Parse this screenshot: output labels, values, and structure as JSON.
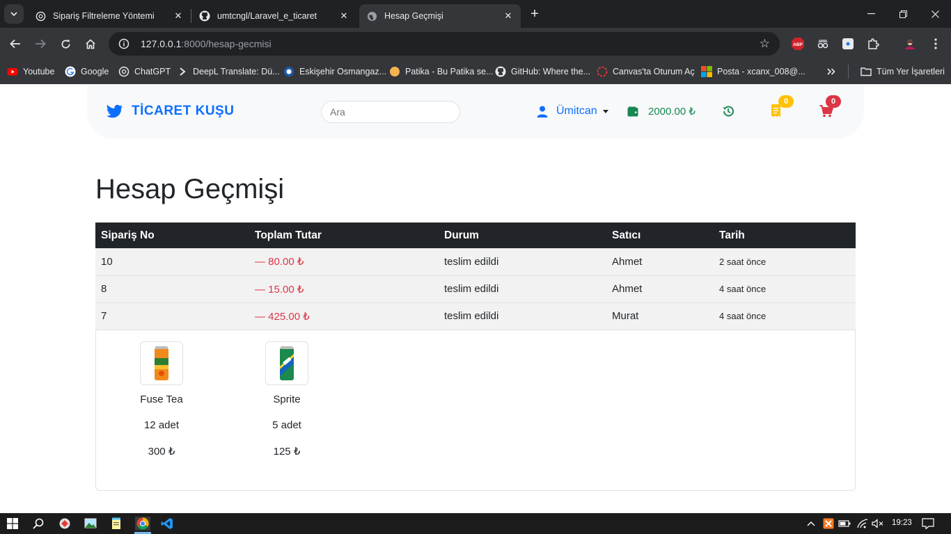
{
  "browser": {
    "tabs": [
      {
        "label": "Sipariş Filtreleme Yöntemi",
        "icon": "chatgpt-icon"
      },
      {
        "label": "umtcngl/Laravel_e_ticaret",
        "icon": "github-icon"
      },
      {
        "label": "Hesap Geçmişi",
        "icon": "globe-icon"
      }
    ],
    "url_host": "127.0.0.1",
    "url_rest": ":8000/hesap-gecmisi",
    "bookmarks": [
      "Youtube",
      "Google",
      "ChatGPT",
      "DeepL Translate: Dü...",
      "Eskişehir Osmangaz...",
      "Patika - Bu Patika se...",
      "GitHub: Where the...",
      "Canvas'ta Oturum Aç",
      "Posta - xcanx_008@...",
      "Tüm Yer İşaretleri"
    ],
    "extension_abp": "ABP"
  },
  "navbar": {
    "brand": "TİCARET KUŞU",
    "search_placeholder": "Ara",
    "user": "Ümitcan",
    "balance": "2000.00 ₺",
    "orders_badge": "0",
    "cart_badge": "0"
  },
  "page": {
    "title": "Hesap Geçmişi",
    "columns": [
      "Sipariş No",
      "Toplam Tutar",
      "Durum",
      "Satıcı",
      "Tarih"
    ],
    "rows": [
      {
        "no": "10",
        "amount": "80.00 ₺",
        "status": "teslim edildi",
        "seller": "Ahmet",
        "date": "2 saat önce"
      },
      {
        "no": "8",
        "amount": "15.00 ₺",
        "status": "teslim edildi",
        "seller": "Ahmet",
        "date": "4 saat önce"
      },
      {
        "no": "7",
        "amount": "425.00 ₺",
        "status": "teslim edildi",
        "seller": "Murat",
        "date": "4 saat önce"
      }
    ],
    "details": [
      {
        "name": "Fuse Tea",
        "qty": "12 adet",
        "price": "300 ₺"
      },
      {
        "name": "Sprite",
        "qty": "5 adet",
        "price": "125 ₺"
      }
    ]
  },
  "taskbar": {
    "time": "19:23"
  },
  "colors": {
    "primary": "#0d6efd",
    "success": "#198754",
    "danger": "#dc3545",
    "warning": "#ffc107",
    "table_header": "#212529"
  }
}
